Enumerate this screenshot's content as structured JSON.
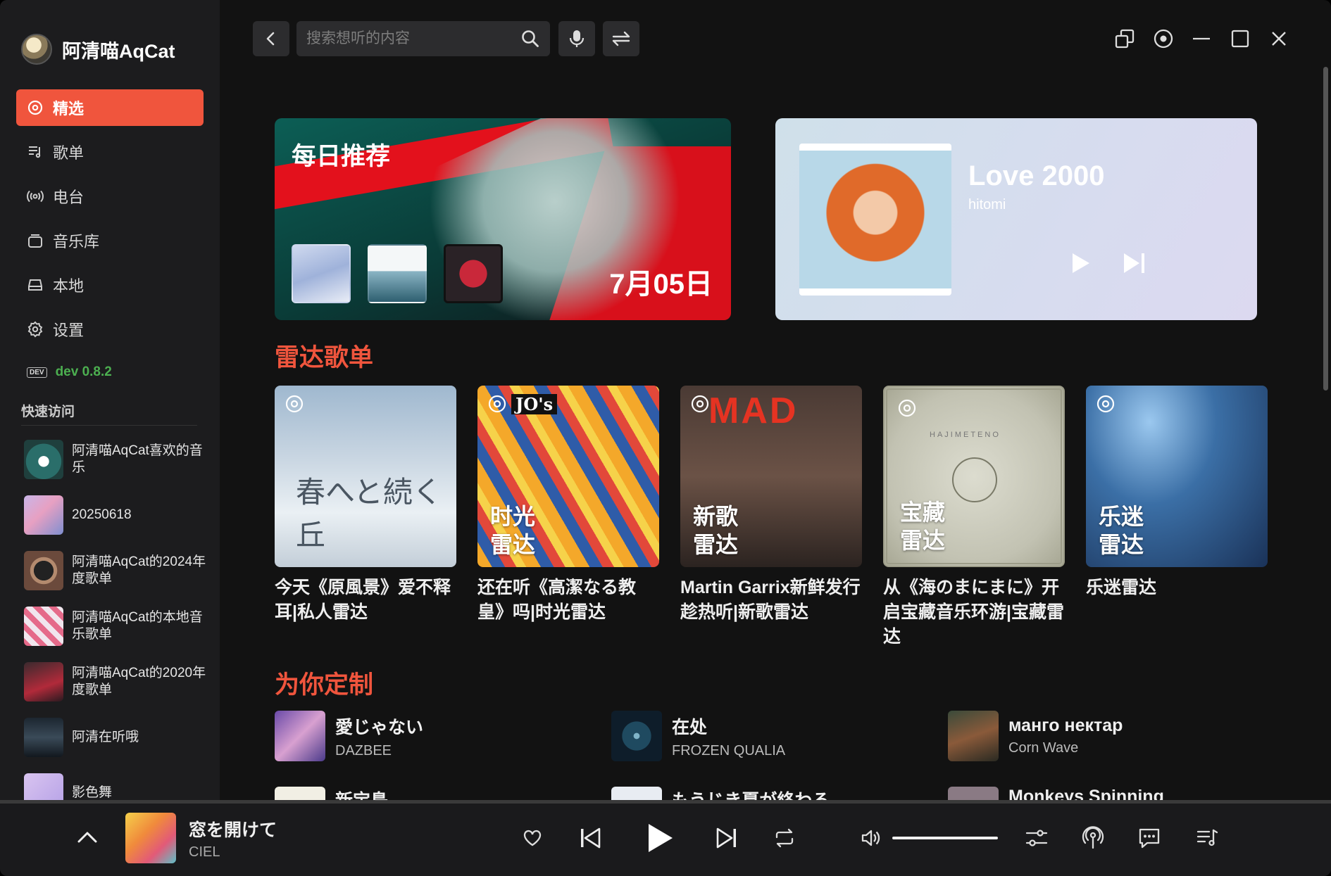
{
  "app": {
    "user_name": "阿清喵AqCat",
    "version": "dev 0.8.2",
    "version_badge": "DEV"
  },
  "nav": {
    "items": [
      {
        "label": "精选",
        "icon": "compass-icon",
        "active": true
      },
      {
        "label": "歌单",
        "icon": "playlist-icon"
      },
      {
        "label": "电台",
        "icon": "radio-icon"
      },
      {
        "label": "音乐库",
        "icon": "library-icon"
      },
      {
        "label": "本地",
        "icon": "drive-icon"
      },
      {
        "label": "设置",
        "icon": "gear-icon"
      }
    ]
  },
  "quick": {
    "title": "快速访问",
    "items": [
      {
        "label": "阿清喵AqCat喜欢的音乐"
      },
      {
        "label": "20250618"
      },
      {
        "label": "阿清喵AqCat的2024年度歌单"
      },
      {
        "label": "阿清喵AqCat的本地音乐歌单"
      },
      {
        "label": "阿清喵AqCat的2020年度歌单"
      },
      {
        "label": "阿清在听哦"
      },
      {
        "label": "影色舞"
      }
    ]
  },
  "search": {
    "placeholder": "搜索想听的内容",
    "value": ""
  },
  "daily": {
    "title": "每日推荐",
    "date": "7月05日"
  },
  "now_card": {
    "title": "Love 2000",
    "artist": "hitomi"
  },
  "radar": {
    "title": "雷达歌单",
    "items": [
      {
        "tag": "",
        "desc": "今天《原風景》爱不释耳|私人雷达",
        "cover_text": "春へと続く丘"
      },
      {
        "tag": "时光雷达",
        "tag1": "时光",
        "tag2": "雷达",
        "desc": "还在听《高潔なる教皇》吗|时光雷达",
        "cover_text": "JO's"
      },
      {
        "tag": "新歌雷达",
        "tag1": "新歌",
        "tag2": "雷达",
        "desc": "Martin Garrix新鲜发行趁热听|新歌雷达",
        "cover_text": "MAD"
      },
      {
        "tag": "宝藏雷达",
        "tag1": "宝藏",
        "tag2": "雷达",
        "desc": "从《海のまにまに》开启宝藏音乐环游|宝藏雷达",
        "cover_text": "HAJIMETENO"
      },
      {
        "tag": "乐迷雷达",
        "tag1": "乐迷",
        "tag2": "雷达",
        "desc": "乐迷雷达",
        "cover_text": ""
      }
    ]
  },
  "custom": {
    "title": "为你定制",
    "items": [
      {
        "title": "愛じゃない",
        "artist": "DAZBEE"
      },
      {
        "title": "在处",
        "artist": "FROZEN QUALIA"
      },
      {
        "title": "манго нектар",
        "artist": "Corn Wave"
      }
    ],
    "peek": [
      "新宝島",
      "もうじき夏が終わる",
      "Monkeys Spinning"
    ]
  },
  "player": {
    "title": "窓を開けて",
    "artist": "CIEL",
    "volume": 1.0
  },
  "colors": {
    "accent": "#f0553d",
    "version_green": "#4caf50"
  }
}
